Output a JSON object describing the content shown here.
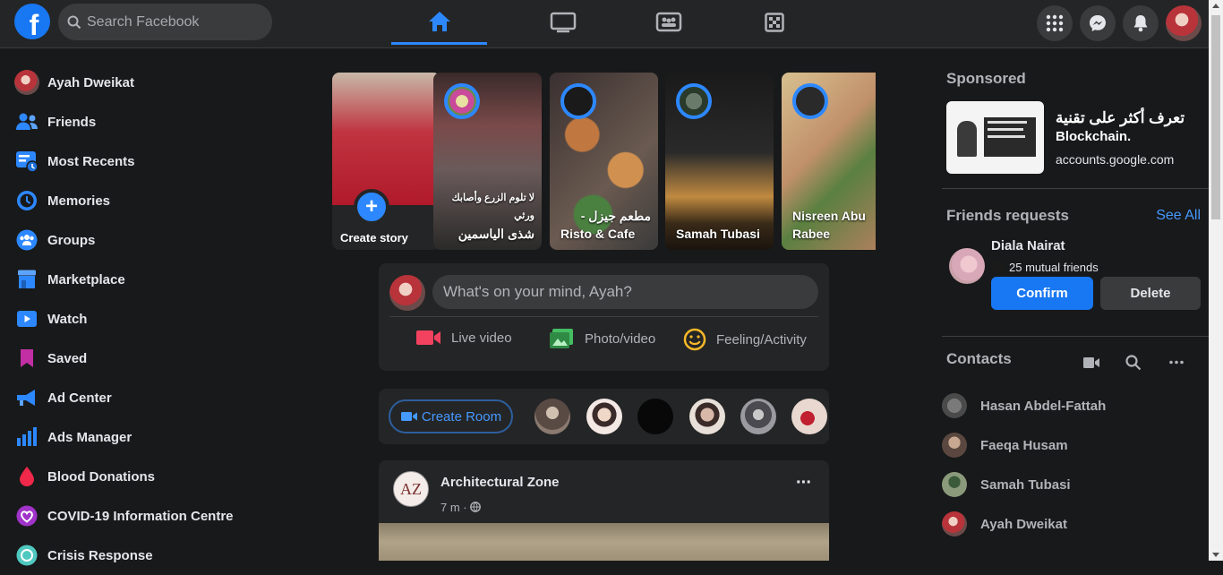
{
  "header": {
    "logo_letter": "f",
    "search_placeholder": "Search Facebook",
    "nav_tabs": [
      {
        "icon": "home-icon",
        "active": true
      },
      {
        "icon": "watch-icon",
        "active": false
      },
      {
        "icon": "groups-icon",
        "active": false
      },
      {
        "icon": "gaming-icon",
        "active": false
      }
    ],
    "right_icons": [
      "menu-grid-icon",
      "messenger-icon",
      "notifications-icon",
      "profile-avatar"
    ]
  },
  "sidebar": {
    "items": [
      {
        "label": "Ayah Dweikat",
        "icon": "profile-avatar"
      },
      {
        "label": "Friends",
        "icon": "friends-icon"
      },
      {
        "label": "Most Recents",
        "icon": "most-recents-icon"
      },
      {
        "label": "Memories",
        "icon": "memories-icon"
      },
      {
        "label": "Groups",
        "icon": "groups-icon"
      },
      {
        "label": "Marketplace",
        "icon": "marketplace-icon"
      },
      {
        "label": "Watch",
        "icon": "watch-icon"
      },
      {
        "label": "Saved",
        "icon": "saved-icon"
      },
      {
        "label": "Ad Center",
        "icon": "ad-center-icon"
      },
      {
        "label": "Ads Manager",
        "icon": "ads-manager-icon"
      },
      {
        "label": "Blood Donations",
        "icon": "blood-donations-icon"
      },
      {
        "label": "COVID-19 Information Centre",
        "icon": "covid-info-icon"
      },
      {
        "label": "Crisis Response",
        "icon": "crisis-response-icon"
      }
    ]
  },
  "stories": {
    "create_label": "Create story",
    "items": [
      {
        "name": "لا تلوم الزرع وأصابك ورثي شذى الياسمين",
        "line1": "لا تلوم الزرع وأصابك ورثي",
        "line2": "شذى الياسمين"
      },
      {
        "name": "مطعم جيزل - Risto & Cafe",
        "line1": "مطعم جيزل -",
        "line2": "Risto & Cafe"
      },
      {
        "name": "Samah Tubasi",
        "line1": "",
        "line2": "Samah Tubasi"
      },
      {
        "name": "Nisreen Abu Rabee",
        "line1": "Nisreen Abu",
        "line2": "Rabee"
      }
    ]
  },
  "composer": {
    "placeholder": "What's on your mind, Ayah?",
    "actions": [
      {
        "label": "Live video",
        "color": "#f3425f"
      },
      {
        "label": "Photo/video",
        "color": "#45bd62"
      },
      {
        "label": "Feeling/Activity",
        "color": "#f7b928"
      }
    ]
  },
  "rooms": {
    "create_label": "Create Room"
  },
  "post": {
    "page_name": "Architectural Zone",
    "time": "7 m ·",
    "more": "···"
  },
  "right": {
    "sponsored_title": "Sponsored",
    "ad": {
      "headline_line1": "تعرف أكثر على تقنية",
      "headline_line2": "Blockchain.",
      "domain": "accounts.google.com"
    },
    "friend_requests": {
      "title": "Friends requests",
      "see_all": "See All",
      "name": "Diala Nairat",
      "mutual": "25 mutual friends",
      "confirm": "Confirm",
      "delete": "Delete"
    },
    "contacts": {
      "title": "Contacts",
      "items": [
        "Hasan Abdel-Fattah",
        "Faeqa Husam",
        "Samah Tubasi",
        "Ayah Dweikat"
      ]
    }
  },
  "colors": {
    "accent": "#1877f2",
    "background": "#18191a",
    "surface": "#242526"
  }
}
